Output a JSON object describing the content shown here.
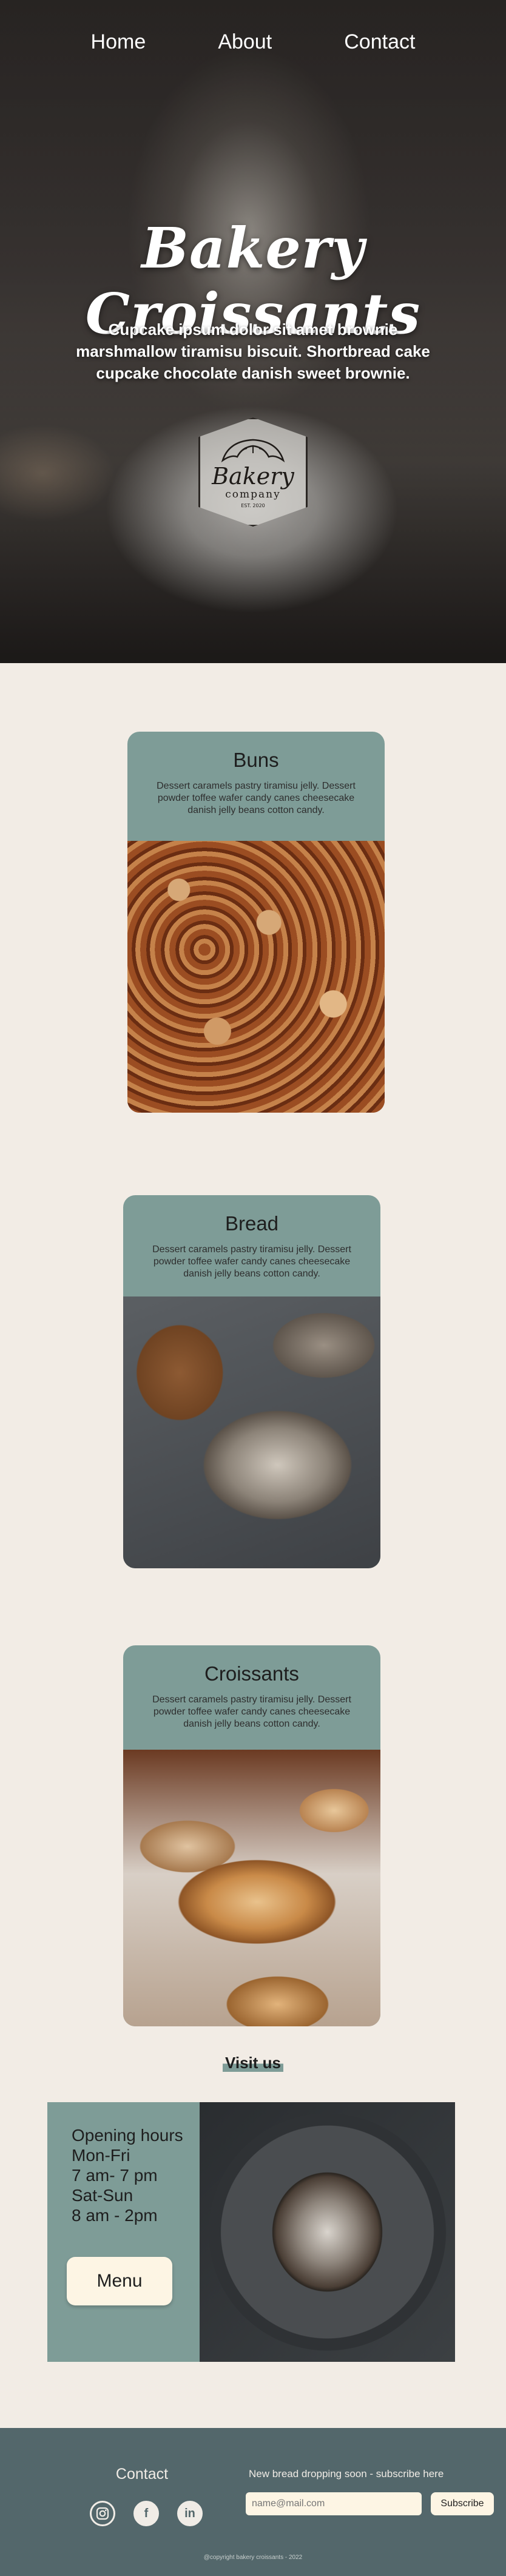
{
  "nav": {
    "home": "Home",
    "about": "About",
    "contact": "Contact"
  },
  "hero": {
    "title": "Bakery Croissants",
    "subtitle": "Cupcake ipsum dolor sit amet brownie marshmallow tiramisu biscuit. Shortbread cake cupcake chocolate danish sweet brownie.",
    "logo": {
      "brand": "Bakery",
      "company": "company",
      "est": "EST. 2020"
    }
  },
  "cards": [
    {
      "title": "Buns",
      "text": "Dessert caramels pastry tiramisu jelly. Dessert powder toffee wafer candy canes cheesecake danish jelly beans cotton candy."
    },
    {
      "title": "Bread",
      "text": "Dessert caramels pastry tiramisu jelly. Dessert powder toffee wafer candy canes cheesecake danish jelly beans cotton candy."
    },
    {
      "title": "Croissants",
      "text": "Dessert caramels pastry tiramisu jelly. Dessert powder toffee wafer candy canes cheesecake danish jelly beans cotton candy."
    }
  ],
  "visit": {
    "title": "Visit us",
    "lines": [
      "Opening hours",
      "Mon-Fri",
      "7 am- 7 pm",
      "Sat-Sun",
      "8 am - 2pm"
    ],
    "menu_label": "Menu"
  },
  "footer": {
    "contact_title": "Contact",
    "socials": [
      "instagram-icon",
      "facebook-icon",
      "linkedin-icon"
    ],
    "subscribe_text": "New bread dropping soon - subscribe here",
    "email_placeholder": "name@mail.com",
    "subscribe_label": "Subscribe",
    "copyright": "@copyright bakery croissants - 2022"
  },
  "colors": {
    "accent": "#7e9c97",
    "footer": "#53676b",
    "background": "#f2ece5",
    "cream": "#fdf5e4"
  }
}
